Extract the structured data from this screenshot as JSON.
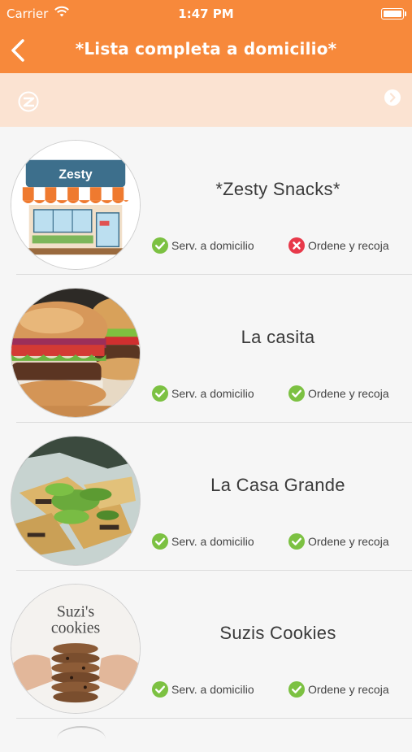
{
  "status_bar": {
    "carrier": "Carrier",
    "time": "1:47 PM"
  },
  "header": {
    "title": "*Lista completa a domicilio*",
    "back_icon": "chevron-left-icon"
  },
  "banner": {
    "logo_icon": "zesty-logo-icon",
    "arrow_icon": "chevron-right-circle-icon"
  },
  "colors": {
    "header_orange": "#f7893b",
    "banner_bg": "#fbe3d2",
    "check_green": "#7cc142",
    "cross_red": "#e8394a"
  },
  "restaurants": [
    {
      "name": "*Zesty Snacks*",
      "image_icon": "storefront-icon",
      "logo_text": "Zesty",
      "delivery": {
        "label": "Serv. a domicilio",
        "available": true
      },
      "pickup": {
        "label": "Ordene y recoja",
        "available": false
      }
    },
    {
      "name": "La casita",
      "image_icon": "burger-photo",
      "delivery": {
        "label": "Serv. a domicilio",
        "available": true
      },
      "pickup": {
        "label": "Ordene y recoja",
        "available": true
      }
    },
    {
      "name": "La Casa Grande",
      "image_icon": "nachos-photo",
      "delivery": {
        "label": "Serv. a domicilio",
        "available": true
      },
      "pickup": {
        "label": "Ordene y recoja",
        "available": true
      }
    },
    {
      "name": "Suzis Cookies",
      "image_icon": "cookies-photo",
      "logo_text_1": "Suzi's",
      "logo_text_2": "cookies",
      "delivery": {
        "label": "Serv. a domicilio",
        "available": true
      },
      "pickup": {
        "label": "Ordene y recoja",
        "available": true
      }
    }
  ]
}
